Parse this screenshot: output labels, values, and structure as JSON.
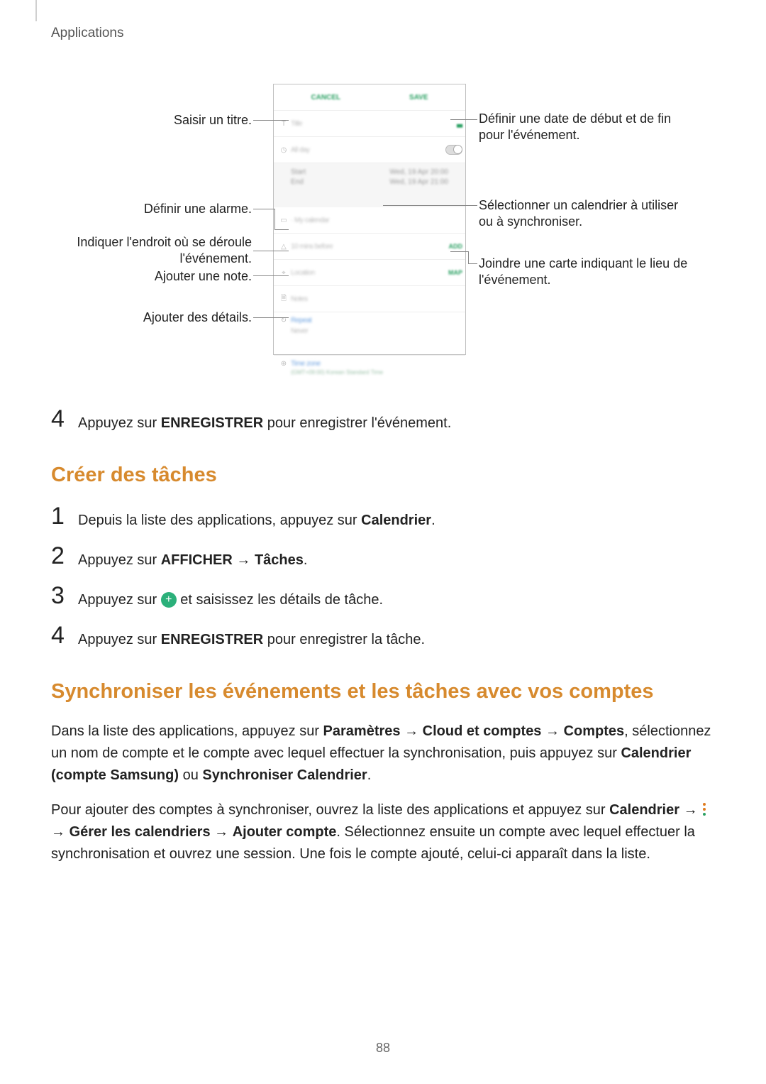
{
  "header": {
    "section": "Applications"
  },
  "figure": {
    "callouts": {
      "title": "Saisir un titre.",
      "date": "Définir une date de début et de fin pour l'événement.",
      "alarm": "Définir une alarme.",
      "calendar": "Sélectionner un calendrier à utiliser ou à synchroniser.",
      "place": "Indiquer l'endroit où se déroule l'événement.",
      "map": "Joindre une carte indiquant le lieu de l'événement.",
      "note": "Ajouter une note.",
      "details": "Ajouter des détails."
    },
    "mock": {
      "cancel": "CANCEL",
      "save": "SAVE",
      "title_icon": "T",
      "title": "Title",
      "allday": "All day",
      "start": "Start",
      "start_val": "Wed, 19 Apr   20:00",
      "end": "End",
      "end_val": "Wed, 19 Apr   21:00",
      "my_cal": "· My calendar",
      "reminder": "10 mins before",
      "reminder_add": "ADD",
      "location": "Location",
      "map_btn": "MAP",
      "notes": "Notes",
      "repeat": "Repeat",
      "repeat_val": "Never",
      "tz": "Time zone",
      "tz_val": "(GMT+09:00) Korean Standard Time"
    }
  },
  "step4_event": {
    "pre": "Appuyez sur ",
    "bold": "ENREGISTRER",
    "post": " pour enregistrer l'événement."
  },
  "h2_tasks": "Créer des tâches",
  "task_steps": {
    "s1": {
      "pre": "Depuis la liste des applications, appuyez sur ",
      "bold": "Calendrier",
      "post": "."
    },
    "s2": {
      "pre": "Appuyez sur ",
      "b1": "AFFICHER",
      "arrow": " → ",
      "b2": "Tâches",
      "post": "."
    },
    "s3": {
      "pre": "Appuyez sur ",
      "post": " et saisissez les détails de tâche."
    },
    "s4": {
      "pre": "Appuyez sur ",
      "bold": "ENREGISTRER",
      "post": " pour enregistrer la tâche."
    }
  },
  "h2_sync": "Synchroniser les événements et les tâches avec vos comptes",
  "sync_p1": {
    "a": "Dans la liste des applications, appuyez sur ",
    "b1": "Paramètres",
    "ar1": " → ",
    "b2": "Cloud et comptes",
    "ar2": " → ",
    "b3": "Comptes",
    "b": ", sélectionnez un nom de compte et le compte avec lequel effectuer la synchronisation, puis appuyez sur ",
    "b4": "Calendrier (compte Samsung)",
    "c": " ou ",
    "b5": "Synchroniser Calendrier",
    "d": "."
  },
  "sync_p2": {
    "a": "Pour ajouter des comptes à synchroniser, ouvrez la liste des applications et appuyez sur ",
    "b1": "Calendrier",
    "ar1": " → ",
    "ar2": " → ",
    "b2": "Gérer les calendriers",
    "ar3": " → ",
    "b3": "Ajouter compte",
    "b": ". Sélectionnez ensuite un compte avec lequel effectuer la synchronisation et ouvrez une session. Une fois le compte ajouté, celui-ci apparaît dans la liste."
  },
  "page_number": "88"
}
